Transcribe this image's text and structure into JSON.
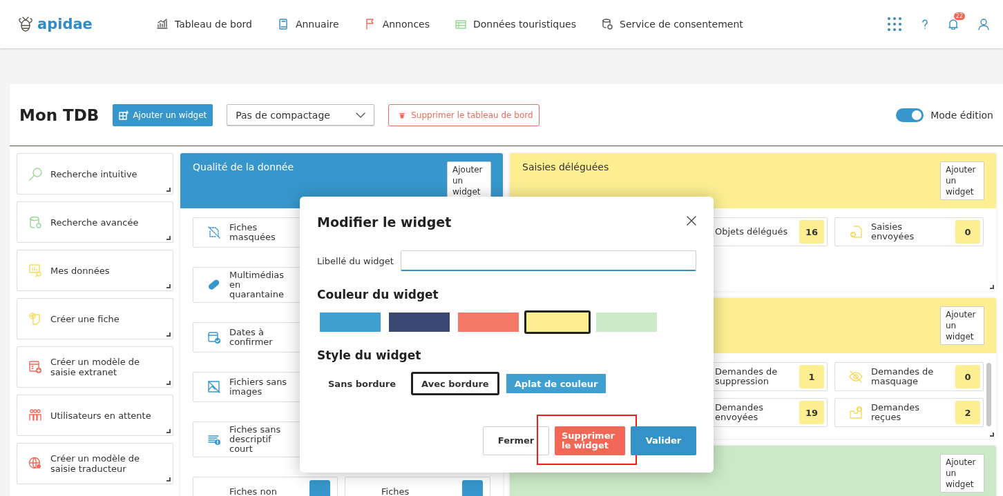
{
  "header": {
    "logo": "apidae",
    "nav": [
      {
        "label": "Tableau de bord"
      },
      {
        "label": "Annuaire"
      },
      {
        "label": "Annonces"
      },
      {
        "label": "Données touristiques"
      },
      {
        "label": "Service de consentement"
      }
    ],
    "notifications": "22"
  },
  "toolbar": {
    "title": "Mon TDB",
    "add_button": "Ajouter un widget",
    "compaction": {
      "value": "Pas de compactage"
    },
    "delete_button": "Supprimer le tableau de bord",
    "edit_mode": {
      "label": "Mode édition",
      "on": true
    }
  },
  "shortcuts": [
    {
      "label": "Recherche intuitive"
    },
    {
      "label": "Recherche avancée"
    },
    {
      "label": "Mes données"
    },
    {
      "label": "Créer une fiche"
    },
    {
      "label": "Créer un modèle de saisie extranet"
    },
    {
      "label": "Utilisateurs en attente"
    },
    {
      "label": "Créer un modèle de saisie traducteur"
    }
  ],
  "widgets": [
    {
      "title": "Qualité de la donnée",
      "color": "#3797cc",
      "add_button": "Ajouter un widget",
      "items": [
        {
          "label": "Fiches masquées"
        },
        {
          "label": "Multimédias en quarantaine"
        },
        {
          "label": "Dates à confirmer"
        },
        {
          "label": "Fichiers sans images"
        },
        {
          "label": "Fiches sans descriptif court"
        },
        {
          "label": "Fiches non"
        },
        {
          "label": "Fiches"
        }
      ]
    },
    {
      "title": "Saisies déléguées",
      "color": "#fcee91",
      "add_button": "Ajouter un widget",
      "items": [
        {
          "label": "Objets délégués",
          "count": "16"
        },
        {
          "label": "Saisies envoyées",
          "count": "0"
        }
      ]
    },
    {
      "color": "#fcee91",
      "add_button": "Ajouter un widget",
      "items": [
        {
          "label": "Demandes de suppression",
          "count": "1"
        },
        {
          "label": "Demandes de masquage",
          "count": "0"
        },
        {
          "label": "Demandes envoyées",
          "count": "19"
        },
        {
          "label": "Demandes reçues",
          "count": "2"
        }
      ]
    },
    {
      "color": "#cbe9c6",
      "add_button": "Ajouter un widget"
    }
  ],
  "modal": {
    "title": "Modifier le widget",
    "field_label": "Libellé du widget",
    "color_heading": "Couleur du widget",
    "colors": [
      {
        "color": "#3e9fd0",
        "selected": false
      },
      {
        "color": "#3a4873",
        "selected": false
      },
      {
        "color": "#f47867",
        "selected": false
      },
      {
        "color": "#fcee91",
        "selected": true
      },
      {
        "color": "#cbebc6",
        "selected": false
      }
    ],
    "style_heading": "Style du widget",
    "styles": [
      {
        "label": "Sans bordure",
        "kind": "plain",
        "selected": false
      },
      {
        "label": "Avec bordure",
        "kind": "border",
        "selected": true
      },
      {
        "label": "Aplat de couleur",
        "kind": "filled",
        "selected": false
      }
    ],
    "buttons": [
      {
        "label": "Fermer",
        "kind": "secondary",
        "highlighted": false
      },
      {
        "label": "Supprimer le widget",
        "kind": "danger",
        "highlighted": true
      },
      {
        "label": "Valider",
        "kind": "primary",
        "highlighted": false
      }
    ]
  }
}
